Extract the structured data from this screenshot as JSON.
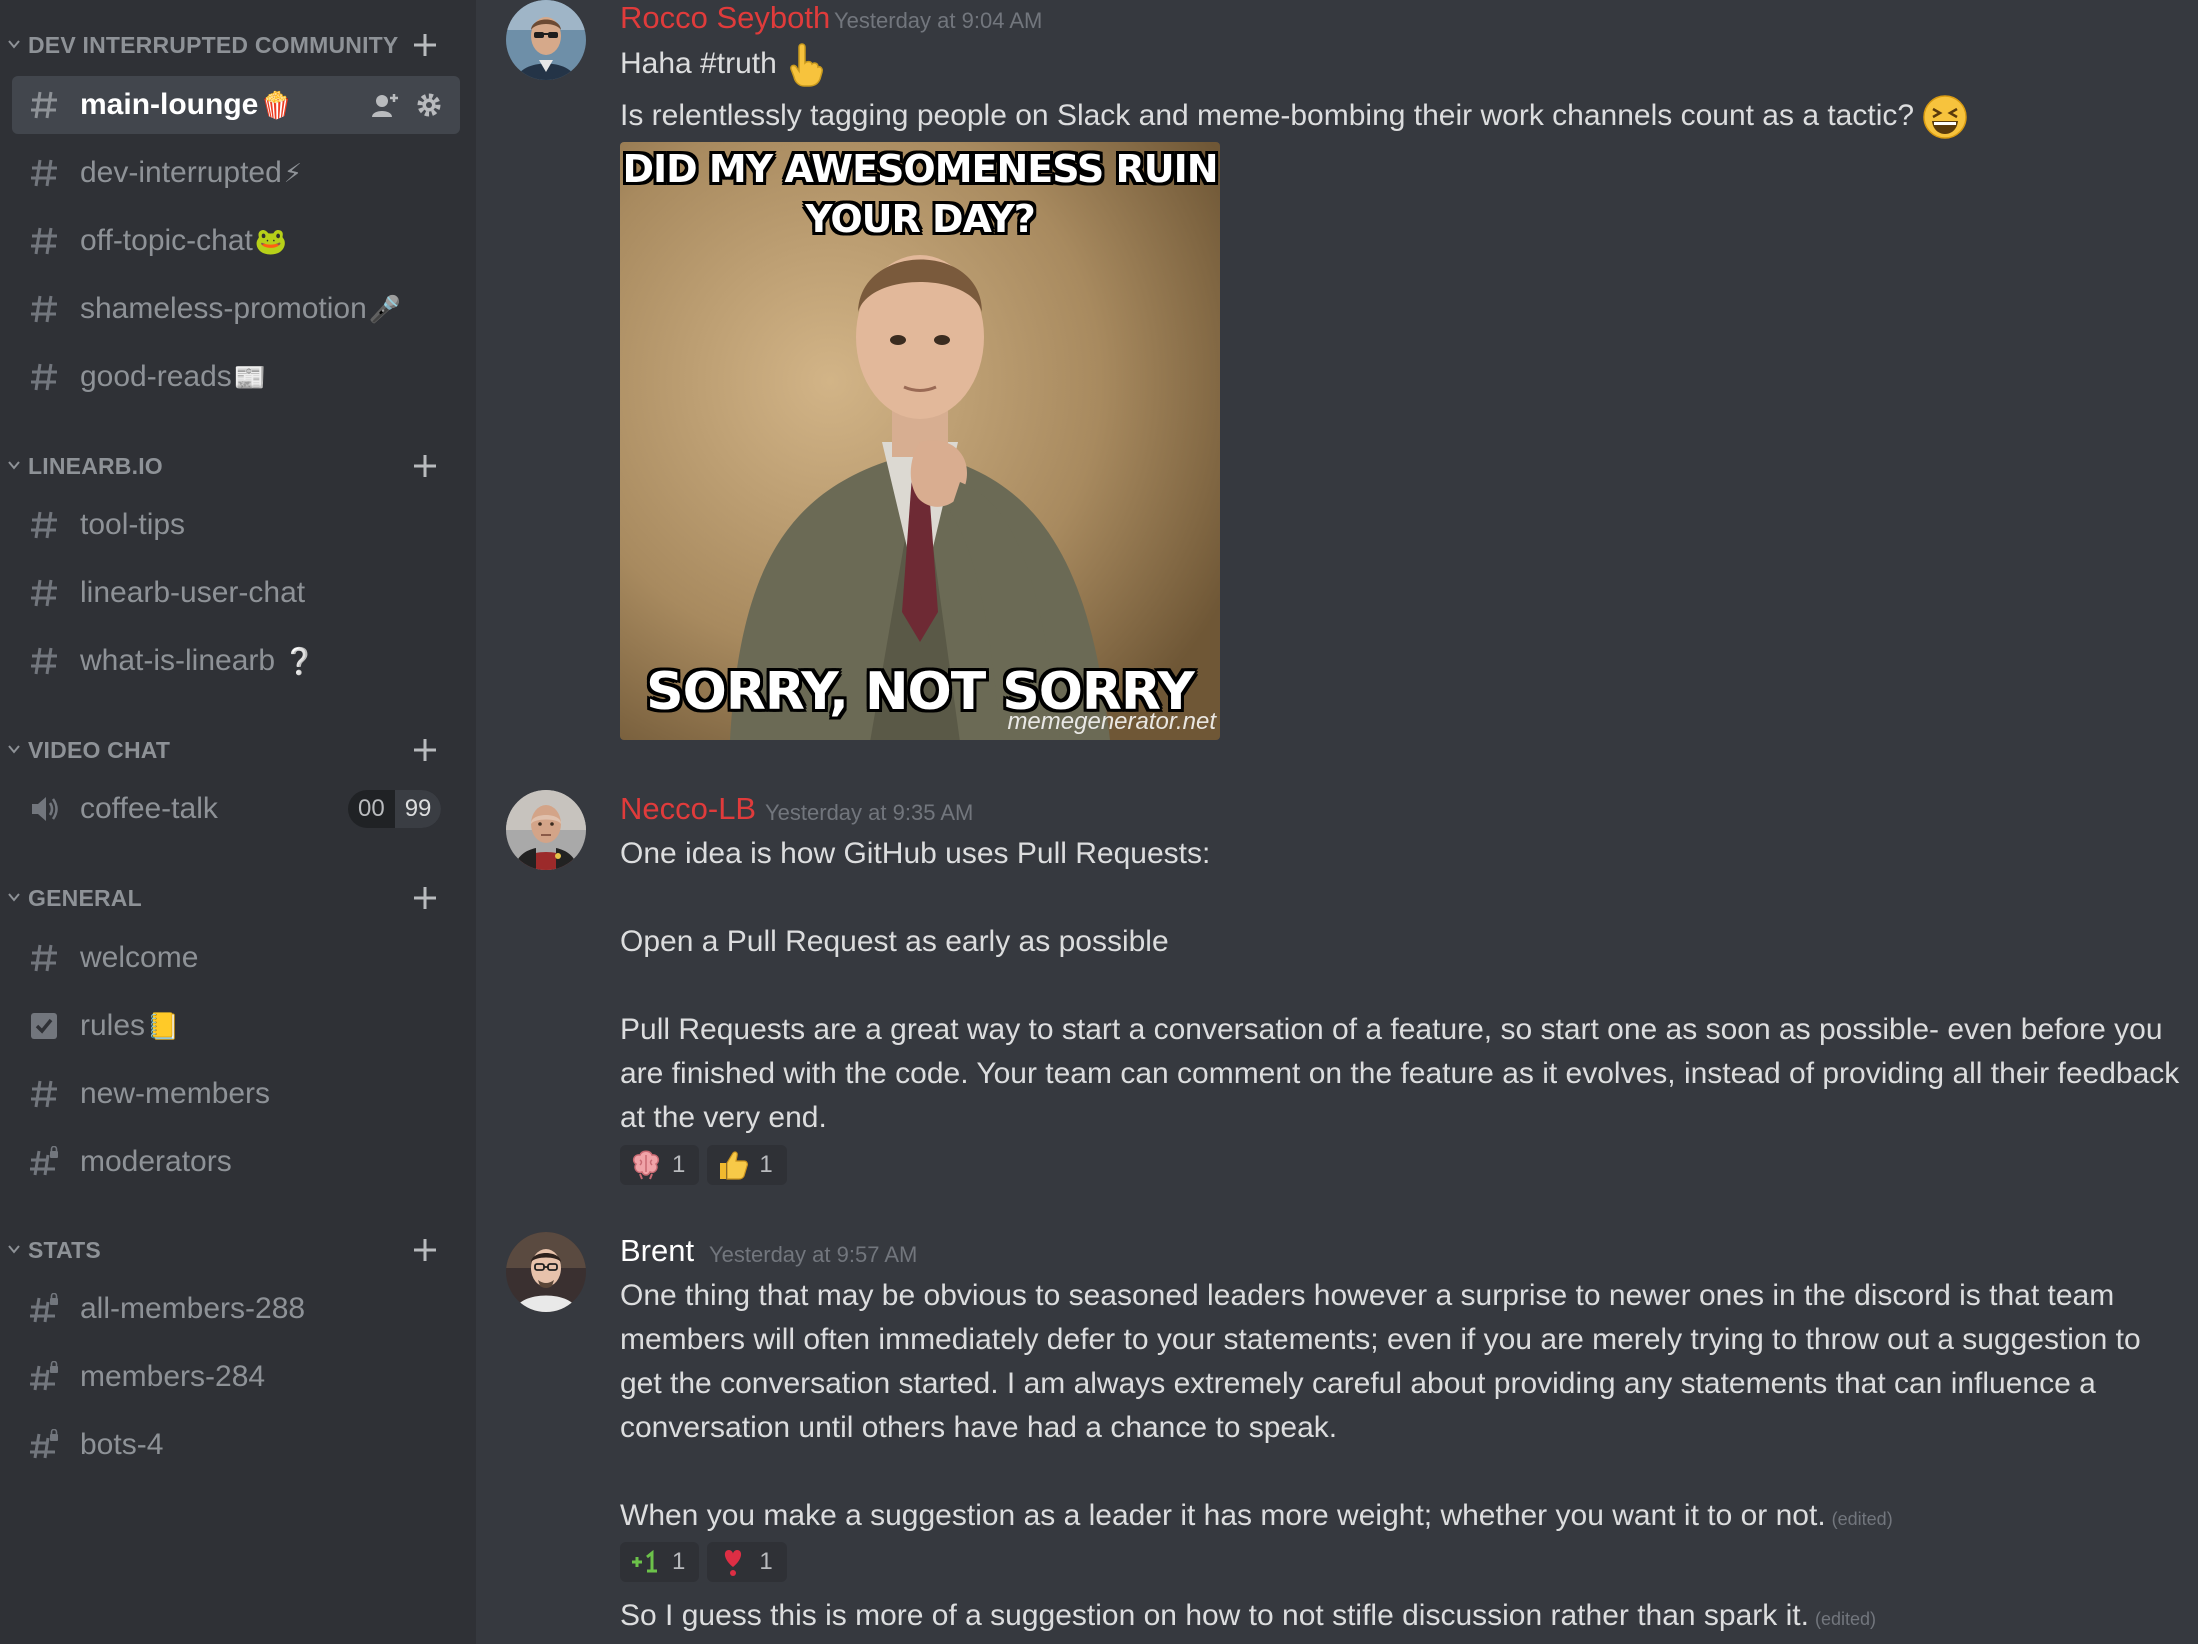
{
  "sidebar": {
    "categories": [
      {
        "label": "DEV INTERRUPTED COMMUNITY"
      },
      {
        "label": "LINEARB.IO"
      },
      {
        "label": "VIDEO CHAT"
      },
      {
        "label": "GENERAL"
      },
      {
        "label": "STATS"
      }
    ],
    "channels": {
      "main_lounge": {
        "name": "main-lounge",
        "emoji": "🍿"
      },
      "dev_interrupted": {
        "name": "dev-interrupted",
        "emoji": "⚡"
      },
      "off_topic_chat": {
        "name": "off-topic-chat",
        "emoji": "🐸"
      },
      "shameless_promotion": {
        "name": "shameless-promotion",
        "emoji": "🎤"
      },
      "good_reads": {
        "name": "good-reads",
        "emoji": "📰"
      },
      "tool_tips": {
        "name": "tool-tips"
      },
      "linearb_user_chat": {
        "name": "linearb-user-chat"
      },
      "what_is_linearb": {
        "name": "what-is-linearb",
        "emoji": "❔"
      },
      "coffee_talk": {
        "name": "coffee-talk",
        "counter_left": "00",
        "counter_right": "99"
      },
      "welcome": {
        "name": "welcome"
      },
      "rules": {
        "name": "rules",
        "emoji": "📒"
      },
      "new_members": {
        "name": "new-members"
      },
      "moderators": {
        "name": "moderators"
      },
      "all_members": {
        "name": "all-members-288"
      },
      "members": {
        "name": "members-284"
      },
      "bots": {
        "name": "bots-4"
      }
    }
  },
  "messages": [
    {
      "author": "Rocco Seyboth",
      "author_color": "#e03b3b",
      "timestamp": "Yesterday at 9:04 AM",
      "line1": "Haha #truth",
      "line2": "Is relentlessly tagging people on Slack and meme-bombing their work channels count as a tactic?",
      "meme_top": "DID MY AWESOMENESS RUIN YOUR DAY?",
      "meme_bottom": "SORRY, NOT SORRY",
      "meme_watermark": "memegenerator.net"
    },
    {
      "author": "Necco-LB",
      "author_color": "#e03b3b",
      "timestamp": "Yesterday at 9:35 AM",
      "para1": "One idea is how GitHub uses Pull Requests:",
      "para2": "Open a Pull Request as early as possible",
      "para3": "Pull Requests are a great way to start a conversation of a feature, so start one as soon as possible- even before you are finished with the code. Your team can comment on the feature as it evolves, instead of providing all their feedback at the very end.",
      "reactions": [
        {
          "emoji": "brain-icon",
          "count": "1"
        },
        {
          "emoji": "thumbs-up-icon",
          "count": "1"
        }
      ]
    },
    {
      "author": "Brent",
      "author_color": "#ffffff",
      "timestamp": "Yesterday at 9:57 AM",
      "para1": "One thing that may be obvious to seasoned leaders however a surprise to newer ones in the discord is that team members will often immediately defer to your statements; even if you are merely trying to throw out a suggestion to get the conversation started.  I am always extremely careful about providing any statements that can influence a conversation until others have had a chance to speak.",
      "para2": "When you make a suggestion as a leader it has more weight; whether you want it to or not.",
      "para2_edited": "(edited)",
      "reactions": [
        {
          "emoji": "plus-one-icon",
          "count": "1"
        },
        {
          "emoji": "heart-exclamation-icon",
          "count": "1"
        }
      ],
      "para3": "So I guess this is more of a suggestion on how to not stifle discussion rather than spark it.",
      "para3_edited": "(edited)"
    }
  ]
}
